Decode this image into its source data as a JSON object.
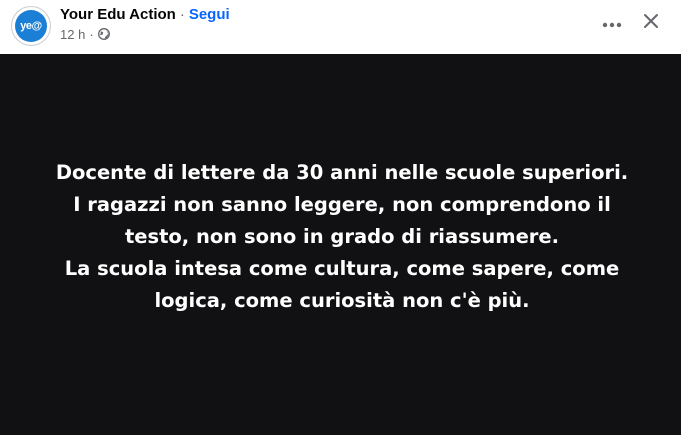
{
  "post": {
    "author": "Your Edu Action",
    "separator": "·",
    "follow_label": "Segui",
    "avatar_text": "ye@",
    "time": "12 h",
    "meta_separator": "·",
    "privacy_icon": "globe-icon",
    "more_icon": "more-horizontal-icon",
    "close_icon": "close-icon",
    "image_text_lines": [
      "Docente di lettere da 30 anni nelle scuole superiori.",
      "I ragazzi non sanno leggere, non comprendono il",
      "testo, non sono in grado di riassumere.",
      "La scuola intesa come cultura, come sapere, come",
      "logica, come curiosità non c'è più."
    ]
  },
  "colors": {
    "accent": "#0866ff",
    "image_background": "#111113",
    "avatar": "#1b7fd6"
  }
}
